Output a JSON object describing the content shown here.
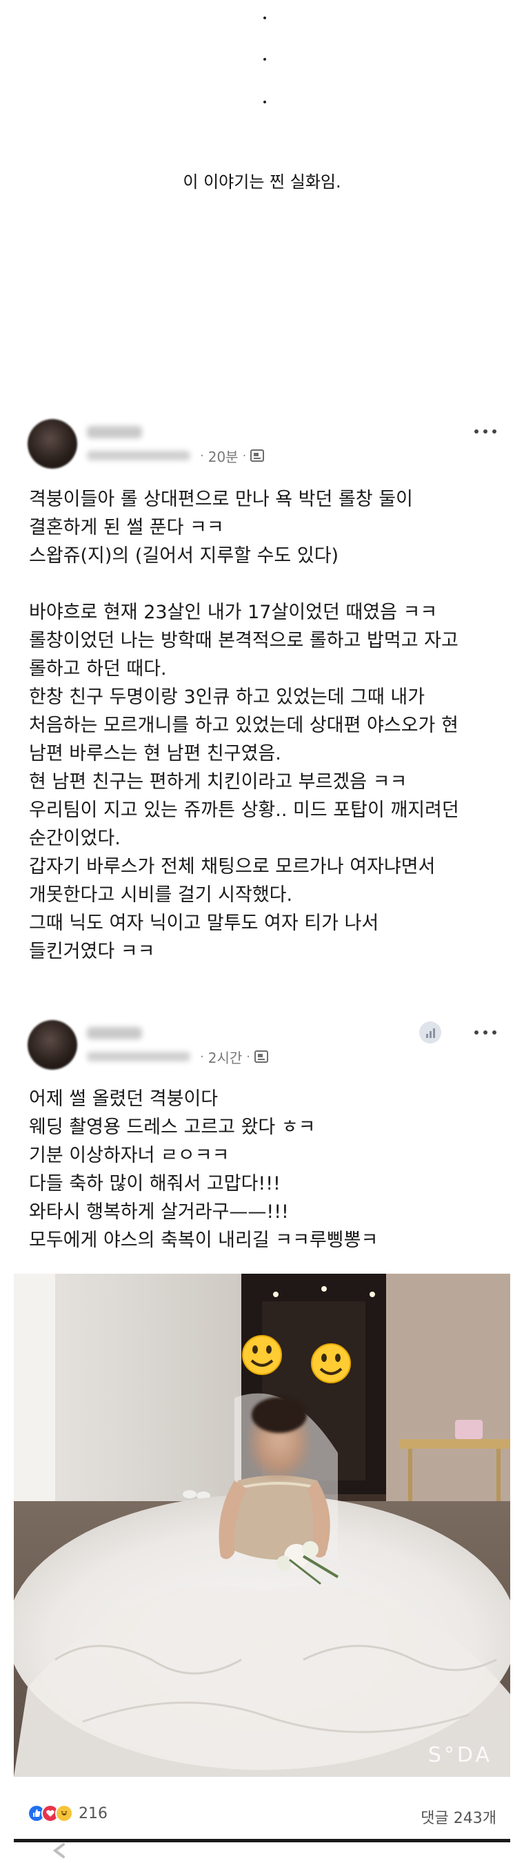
{
  "intro": {
    "dots": [
      ".",
      ".",
      "."
    ],
    "text": "이 이야기는 찐 실화임."
  },
  "post1": {
    "time": "20분",
    "body": "격붕이들아 롤 상대편으로 만나 욕 박던 롤창 둘이\n결혼하게 된 썰 푼다 ㅋㅋ\n스왑쥬(지)의 (길어서 지루할 수도 있다)\n\n바야흐로 현재 23살인 내가 17살이었던 때였음 ㅋㅋ\n롤창이었던 나는 방학때 본격적으로 롤하고 밥먹고 자고\n롤하고 하던 때다.\n한창 친구 두명이랑 3인큐 하고 있었는데 그때 내가\n처음하는 모르개니를 하고 있었는데 상대편 야스오가 현\n남편 바루스는 현 남편 친구였음.\n현 남편 친구는 편하게 치킨이라고 부르겠음 ㅋㅋ\n우리팀이 지고 있는 쥬까튼 상황.. 미드 포탑이 깨지려던\n순간이었다.\n갑자기 바루스가 전체 채팅으로 모르가나 여자냐면서\n개못한다고 시비를 걸기 시작했다.\n그때 닉도 여자 닉이고 말투도 여자 티가 나서\n들킨거였다 ㅋㅋ"
  },
  "post2": {
    "time": "2시간",
    "body": "어제 썰 올렸던 격붕이다\n웨딩 촬영용 드레스 고르고 왔다 ㅎㅋ\n기분 이상하자너 ㄹㅇㅋㅋ\n다들 축하 많이 해줘서 고맙다!!!\n와타시 행복하게 살거라구——!!!\n모두에게 야스의 축복이 내리길 ㅋㅋ루삥뽕ㅋ",
    "photo_watermark": "S°DA",
    "reaction_count": "216",
    "comment_count": "댓글 243개"
  },
  "colors": {
    "like": "#1f6ff0",
    "love": "#e8334a",
    "haha": "#f6c33a"
  },
  "icons": [
    "more-icon",
    "globe-icon",
    "stats-icon",
    "like-icon",
    "love-icon",
    "haha-icon",
    "smiley-face-icon",
    "chevron-left-icon"
  ]
}
